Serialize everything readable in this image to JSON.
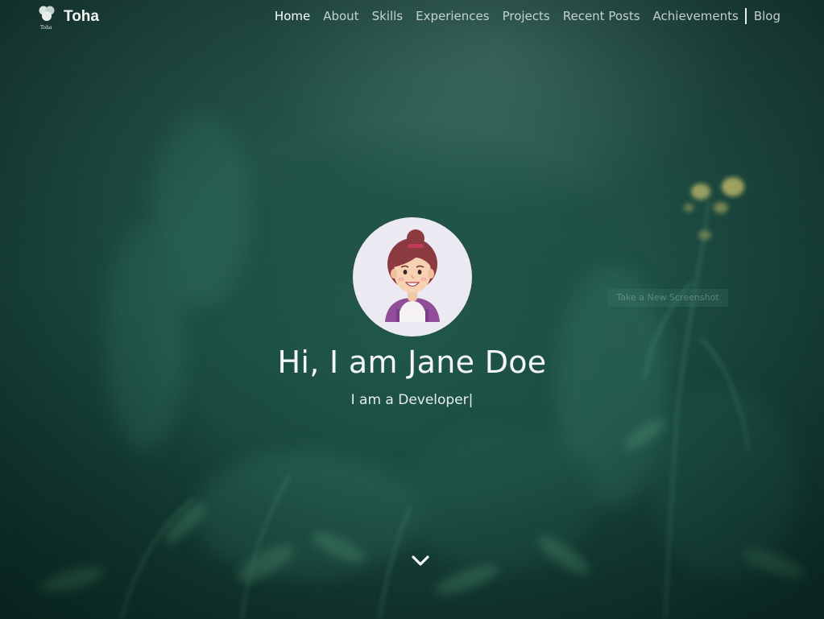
{
  "brand": {
    "name": "Toha",
    "logo_text": "Toha"
  },
  "nav": {
    "items": [
      {
        "label": "Home",
        "active": true
      },
      {
        "label": "About",
        "active": false
      },
      {
        "label": "Skills",
        "active": false
      },
      {
        "label": "Experiences",
        "active": false
      },
      {
        "label": "Projects",
        "active": false
      },
      {
        "label": "Recent Posts",
        "active": false
      },
      {
        "label": "Achievements",
        "active": false
      }
    ],
    "external": {
      "label": "Blog"
    }
  },
  "hero": {
    "greeting": "Hi, I am Jane Doe",
    "tagline": "I am a Developer|",
    "avatar_icon": "female-avatar-icon",
    "scroll_icon": "chevron-down-icon"
  },
  "overlay": {
    "screenshot_label": "Take a New Screenshot"
  },
  "colors": {
    "background": "#1f4f45",
    "text": "#f4f7f6",
    "avatar_bg": "#ece9f3"
  }
}
